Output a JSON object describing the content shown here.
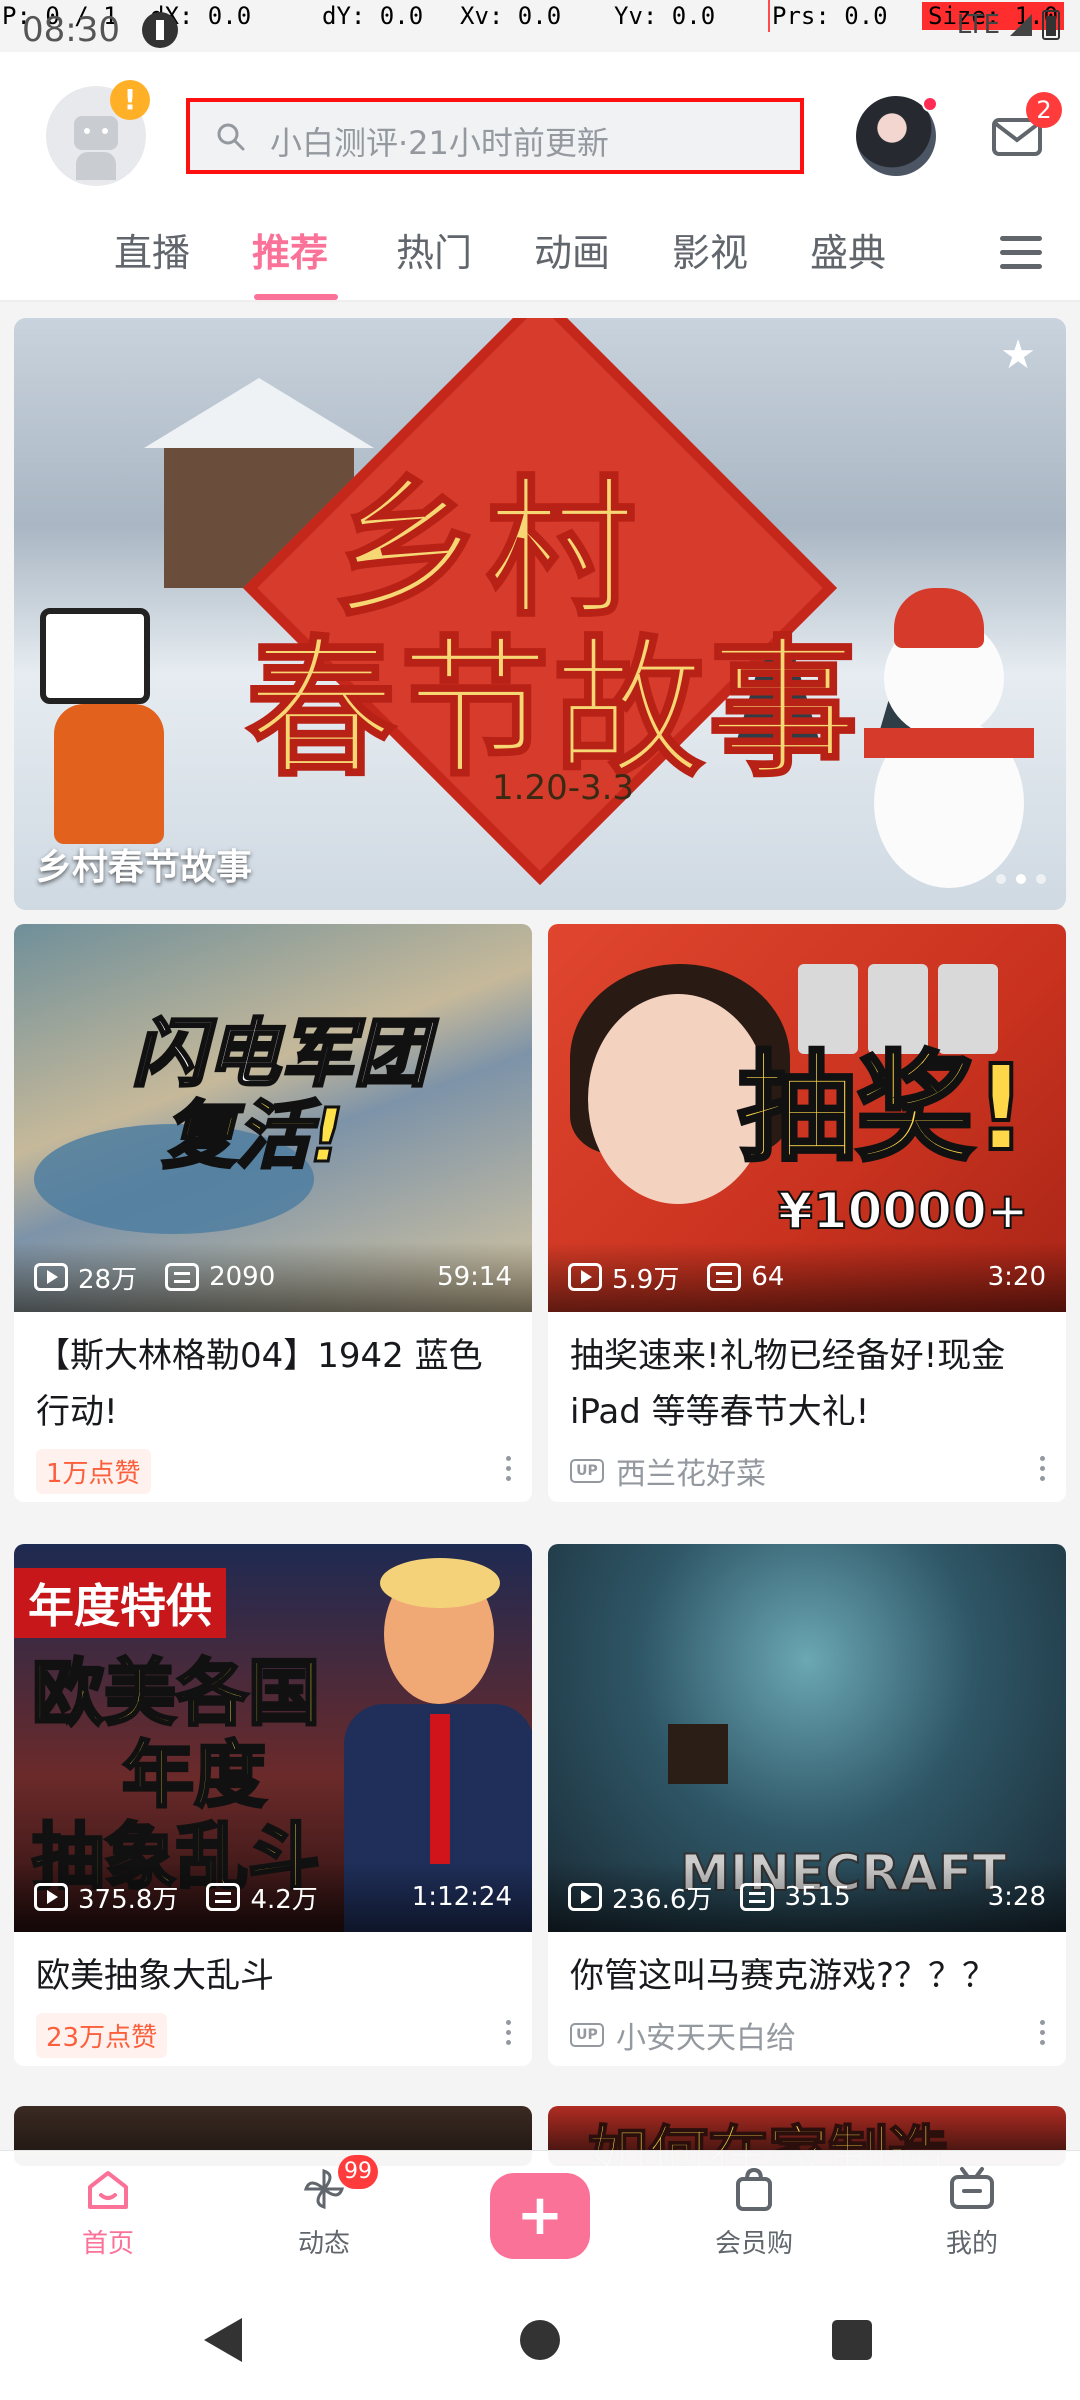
{
  "debug": {
    "pointer": "P: 0 / 1",
    "dx": "dX: 0.0",
    "dy": "dY: 0.0",
    "xv": "Xv: 0.0",
    "yv": "Yv: 0.0",
    "prs": "Prs: 0.0",
    "size": "Size: 1.0"
  },
  "status_bar": {
    "time": "08:30",
    "network": "LTE"
  },
  "header": {
    "search_placeholder": "小白测评·21小时前更新",
    "mail_badge": "2",
    "warning_badge": "!"
  },
  "tabs": [
    {
      "label": "直播"
    },
    {
      "label": "推荐"
    },
    {
      "label": "热门"
    },
    {
      "label": "动画"
    },
    {
      "label": "影视"
    },
    {
      "label": "盛典"
    }
  ],
  "banner": {
    "caption": "乡村春节故事",
    "art_title_1": "乡村",
    "art_title_2": "春节故事",
    "art_date": "1.20-3.3",
    "star_glyph": "★"
  },
  "cards": [
    {
      "views": "28万",
      "danmaku": "2090",
      "duration": "59:14",
      "title": "【斯大林格勒04】1942 蓝色行动!",
      "like_badge": "1万点赞",
      "thumb_text_1": "闪电军团",
      "thumb_text_2": "复活!"
    },
    {
      "views": "5.9万",
      "danmaku": "64",
      "duration": "3:20",
      "title": "抽奖速来!礼物已经备好!现金 iPad 等等春节大礼!",
      "uploader": "西兰花好菜",
      "thumb_text_1": "抽奖!",
      "thumb_text_2": "¥10000+"
    },
    {
      "views": "375.8万",
      "danmaku": "4.2万",
      "duration": "1:12:24",
      "title": "欧美抽象大乱斗",
      "like_badge": "23万点赞",
      "thumb_tag": "年度特供",
      "thumb_text_1": "欧美各国",
      "thumb_text_2": "年度",
      "thumb_text_3": "抽象乱斗"
    },
    {
      "views": "236.6万",
      "danmaku": "3515",
      "duration": "3:28",
      "title": "你管这叫马赛克游戏?？？？",
      "uploader": "小安天天白给",
      "thumb_text_1": "MINECRAFT"
    }
  ],
  "row3": {
    "right_thumb_text": "如何在家制造"
  },
  "up_label": "UP",
  "bottom_nav": {
    "home": "首页",
    "dynamic": "动态",
    "dynamic_badge": "99",
    "plus": "+",
    "vip_shop": "会员购",
    "mine": "我的"
  },
  "colors": {
    "accent": "#fb7299",
    "badge_red": "#ff3b3b",
    "like_orange": "#fb5f3c"
  }
}
